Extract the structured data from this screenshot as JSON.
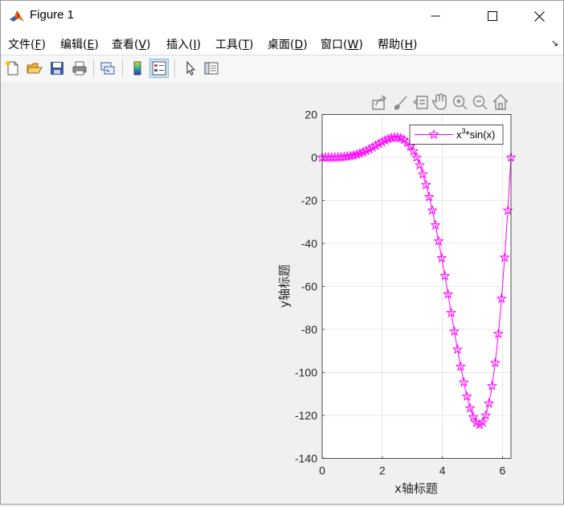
{
  "window": {
    "title": "Figure 1",
    "controls": {
      "minimize": "—",
      "maximize": "☐",
      "close": "✕"
    }
  },
  "menubar": {
    "items": [
      {
        "label": "文件(",
        "acc": "F",
        "end": ")"
      },
      {
        "label": "编辑(",
        "acc": "E",
        "end": ")"
      },
      {
        "label": "查看(",
        "acc": "V",
        "end": ")"
      },
      {
        "label": "插入(",
        "acc": "I",
        "end": ")"
      },
      {
        "label": "工具(",
        "acc": "T",
        "end": ")"
      },
      {
        "label": "桌面(",
        "acc": "D",
        "end": ")"
      },
      {
        "label": "窗口(",
        "acc": "W",
        "end": ")"
      },
      {
        "label": "帮助(",
        "acc": "H",
        "end": ")"
      }
    ],
    "undock_glyph": "↘"
  },
  "toolbar": {
    "buttons": [
      "new-figure-icon",
      "open-file-icon",
      "save-icon",
      "print-icon",
      "link-icon",
      "colorbar-icon",
      "legend-icon",
      "pointer-icon",
      "property-inspector-icon"
    ],
    "active": "legend-icon"
  },
  "axes_toolbar": [
    "export-icon",
    "brush-icon",
    "datatip-icon",
    "pan-icon",
    "zoom-in-icon",
    "zoom-out-icon",
    "home-icon"
  ],
  "chart_data": {
    "type": "line",
    "title": "",
    "xlabel": "x轴标题",
    "ylabel": "y轴标题",
    "xlim": [
      0,
      6.2832
    ],
    "ylim": [
      -140,
      20
    ],
    "xticks": [
      "0",
      "2",
      "4",
      "6"
    ],
    "xtick_values": [
      0,
      2,
      4,
      6
    ],
    "yticks": [
      "20",
      "0",
      "-20",
      "-40",
      "-60",
      "-80",
      "-100",
      "-120",
      "-140"
    ],
    "ytick_values": [
      20,
      0,
      -20,
      -40,
      -60,
      -80,
      -100,
      -120,
      -140
    ],
    "grid": true,
    "legend_placement": "top-right",
    "series": [
      {
        "name": "x³*sin(x)",
        "legend_base": "x",
        "legend_sup": "3",
        "legend_tail": "*sin(x)",
        "color": "#ff00ff",
        "marker": "pentagram",
        "x_start": 0,
        "x_end": 6.2832,
        "n_points": 61,
        "expression": "x^3*sin(x)"
      }
    ]
  }
}
